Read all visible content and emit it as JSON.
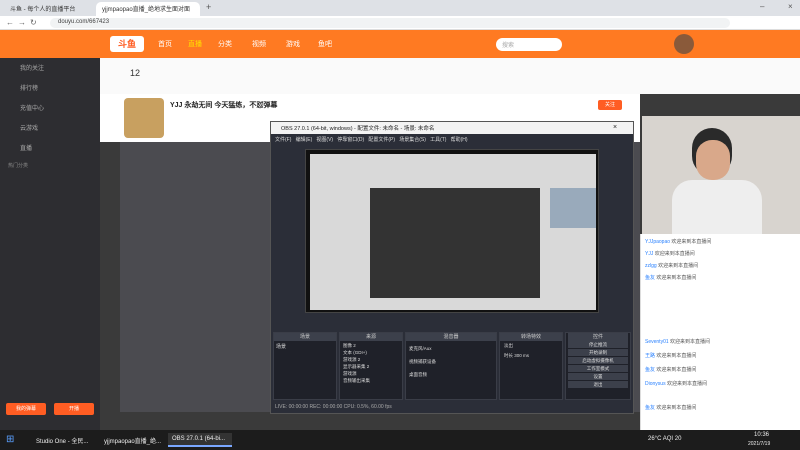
{
  "browser": {
    "tabs": [
      {
        "label": "斗鱼 - 每个人的直播平台"
      },
      {
        "label": "yjjmpaopao直播_绝地求生面对面"
      }
    ],
    "url": "douyu.com/667423"
  },
  "site": {
    "logo": "斗鱼",
    "nav": [
      "首页",
      "直播",
      "分类",
      "视频",
      "游戏",
      "鱼吧"
    ],
    "search_placeholder": "搜索"
  },
  "sidebar": {
    "items": [
      {
        "label": "我的关注"
      },
      {
        "label": "排行榜"
      },
      {
        "label": "充值中心"
      },
      {
        "label": "云游戏"
      },
      {
        "label": "直播"
      }
    ],
    "section": "热门分类",
    "bottom_left": "我的弹幕",
    "bottom_right": "开播"
  },
  "room": {
    "title": "YJJ 永劫无间 今天猛练，不怼弹幕",
    "viewers": "12",
    "follow": "关注"
  },
  "obs": {
    "title": "OBS 27.0.1 (64-bit, windows) - 配置文件: 未命名 - 场景: 未命名",
    "menu": [
      "文件(F)",
      "编辑(E)",
      "视图(V)",
      "停靠窗口(D)",
      "配置文件(P)",
      "场景集合(S)",
      "工具(T)",
      "帮助(H)"
    ],
    "docks": {
      "scenes": "场景",
      "sources": "来源",
      "mixer": "混音器",
      "transitions": "转场特效",
      "controls": "控件"
    },
    "scene_item": "场景",
    "sources": [
      "图像 2",
      "文本 (GDI+)",
      "游戏源 2",
      "显示器采集 2",
      "游戏源",
      "音频输出采集"
    ],
    "mixer": [
      "桌面音频",
      "麦克风/Aux",
      "视频捕获设备"
    ],
    "transition_value": "淡出",
    "duration_label": "时长",
    "duration_value": "300 ms",
    "controls": [
      "停止推流",
      "开始录制",
      "启动虚拟摄像机",
      "工作室模式",
      "设置",
      "退出"
    ],
    "status": "LIVE: 00:00:00   REC: 00:00:00   CPU: 0.5%, 60.00 fps"
  },
  "chat": {
    "lines": [
      {
        "user": "YJJpaopao",
        "text": "欢迎来到本直播间"
      },
      {
        "user": "YJJ",
        "text": "欢迎来到本直播间"
      },
      {
        "user": "zzlgg",
        "text": "欢迎来到本直播间"
      },
      {
        "user": "鱼友",
        "text": "欢迎来到本直播间"
      },
      {
        "user": "Seventy01",
        "text": "欢迎来到本直播间"
      },
      {
        "user": "王路",
        "text": "欢迎来到本直播间"
      },
      {
        "user": "鱼友",
        "text": "欢迎来到本直播间"
      },
      {
        "user": "Dionysus",
        "text": "欢迎来到本直播间"
      },
      {
        "user": "鱼友",
        "text": "欢迎来到本直播间"
      }
    ]
  },
  "taskbar": {
    "items": [
      "Studio One - 全民...",
      "yjjmpaopao直播_绝...",
      "OBS 27.0.1 (64-bi..."
    ],
    "weather": "26°C  AQI 20",
    "time": "10:36",
    "date": "2021/7/19"
  }
}
